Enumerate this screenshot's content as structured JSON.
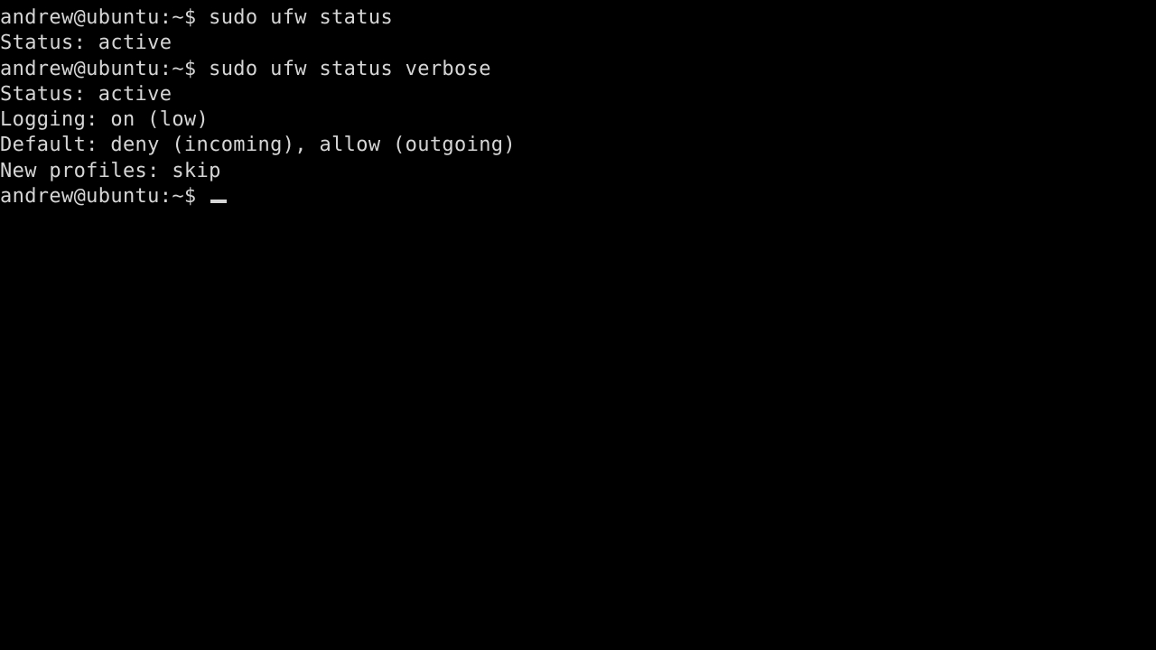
{
  "terminal": {
    "theme": {
      "background": "#000000",
      "foreground": "#d6d6d6",
      "cursor_color": "#d6d6d6"
    },
    "cursor": {
      "shape": "underscore-block",
      "visible": true,
      "line_index": 7,
      "column": 17
    },
    "prompt": "andrew@ubuntu:~$",
    "user": "andrew",
    "host": "ubuntu",
    "cwd_symbol": "~",
    "lines": [
      {
        "type": "prompt",
        "prompt": "andrew@ubuntu:~$",
        "command": " sudo ufw status",
        "text": "andrew@ubuntu:~$ sudo ufw status"
      },
      {
        "type": "output",
        "text": "Status: active"
      },
      {
        "type": "prompt",
        "prompt": "andrew@ubuntu:~$",
        "command": " sudo ufw status verbose",
        "text": "andrew@ubuntu:~$ sudo ufw status verbose"
      },
      {
        "type": "output",
        "text": "Status: active"
      },
      {
        "type": "output",
        "text": "Logging: on (low)"
      },
      {
        "type": "output",
        "text": "Default: deny (incoming), allow (outgoing)"
      },
      {
        "type": "output",
        "text": "New profiles: skip"
      },
      {
        "type": "prompt",
        "prompt": "andrew@ubuntu:~$",
        "command": " ",
        "text": "andrew@ubuntu:~$ "
      }
    ],
    "ufw_status": {
      "status_label": "Status:",
      "status_value": "active",
      "logging_label": "Logging:",
      "logging_value": "on (low)",
      "default_label": "Default:",
      "default_value": "deny (incoming), allow (outgoing)",
      "new_profiles_label": "New profiles:",
      "new_profiles_value": "skip"
    },
    "commands": [
      "sudo ufw status",
      "sudo ufw status verbose"
    ]
  }
}
